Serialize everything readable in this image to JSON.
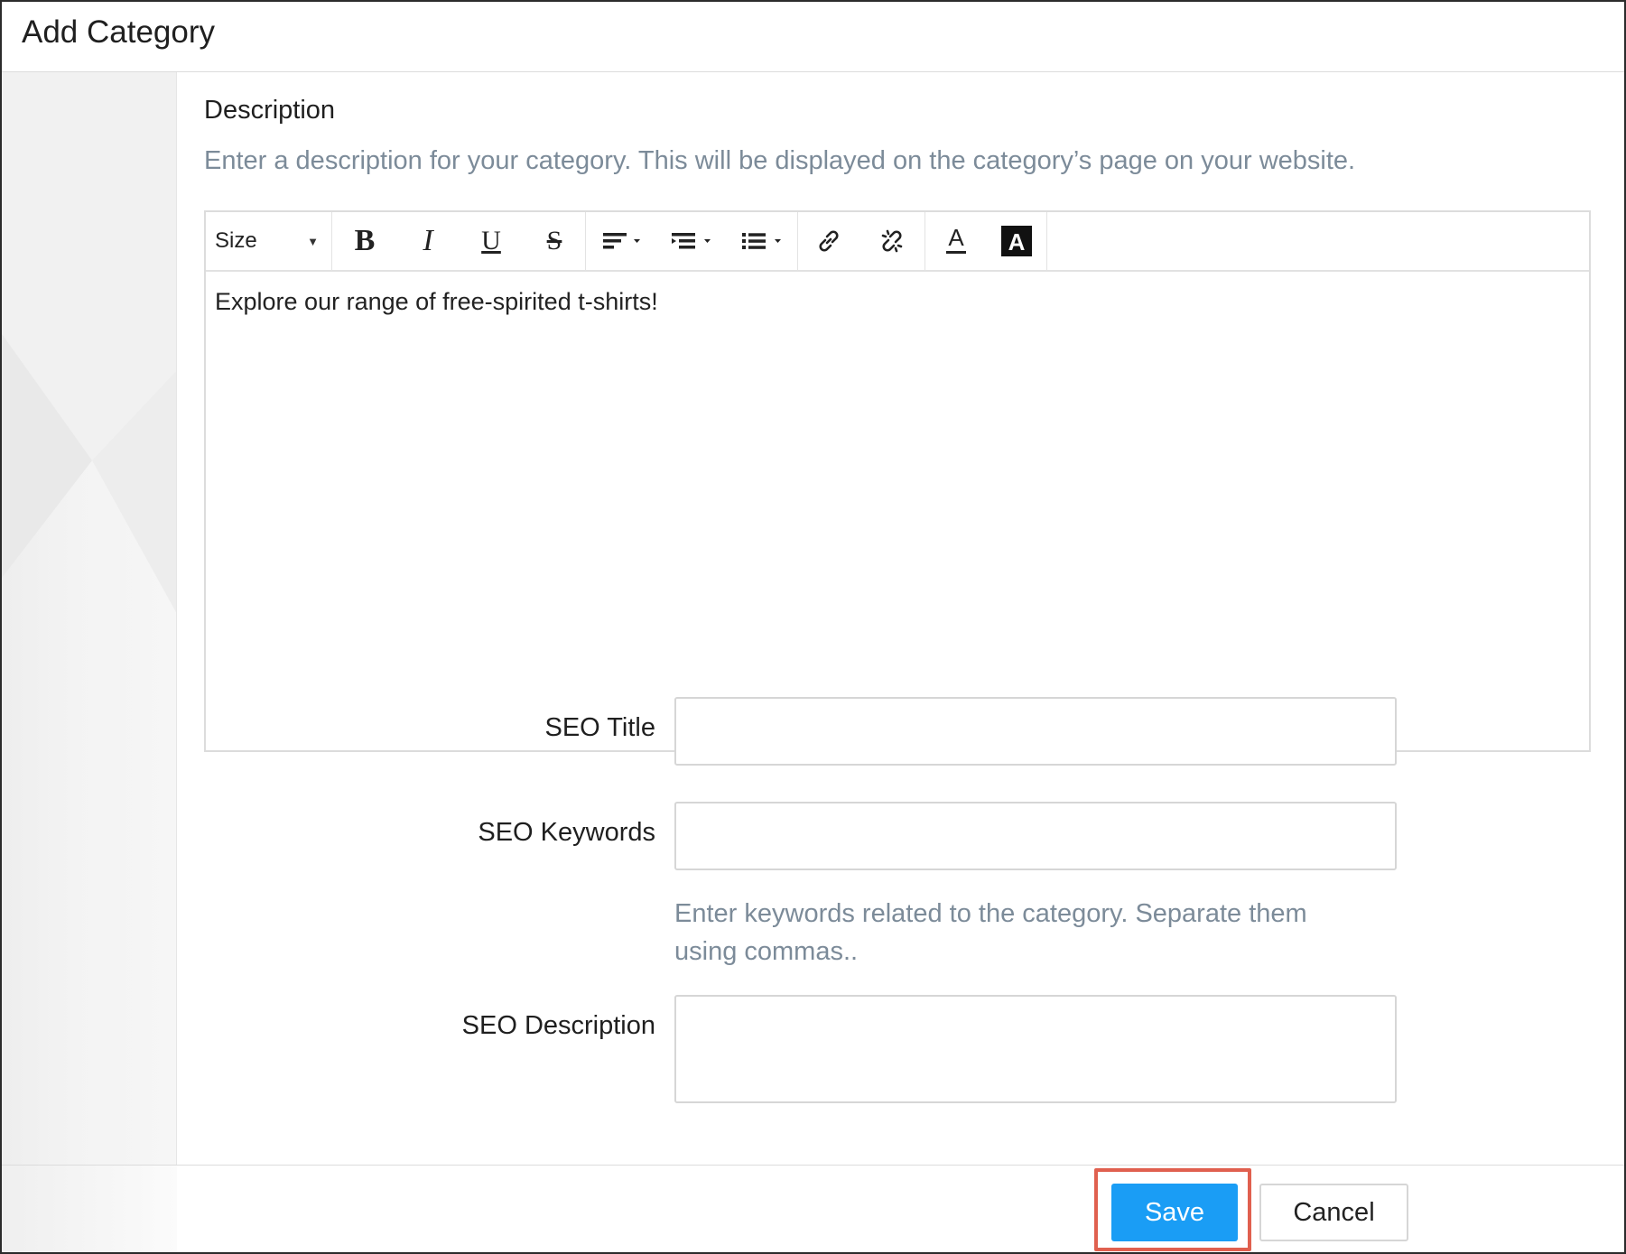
{
  "dialog": {
    "title": "Add Category"
  },
  "description": {
    "label": "Description",
    "help": "Enter a description for your category. This will be displayed on the category’s page on your website."
  },
  "editor": {
    "size_label": "Size",
    "content": "Explore our range of free-spirited t-shirts!",
    "toolbar_icons": [
      "bold-icon",
      "italic-icon",
      "underline-icon",
      "strikethrough-icon",
      "align-icon",
      "indent-icon",
      "list-icon",
      "link-icon",
      "unlink-icon",
      "text-color-icon",
      "background-color-icon"
    ]
  },
  "seo": {
    "title_label": "SEO Title",
    "title_value": "",
    "keywords_label": "SEO Keywords",
    "keywords_value": "",
    "keywords_help": "Enter keywords related to the category. Separate them using commas..",
    "description_label": "SEO Description",
    "description_value": ""
  },
  "footer": {
    "save_label": "Save",
    "cancel_label": "Cancel",
    "save_color": "#1a9df5",
    "highlight_color": "#e0604f"
  }
}
